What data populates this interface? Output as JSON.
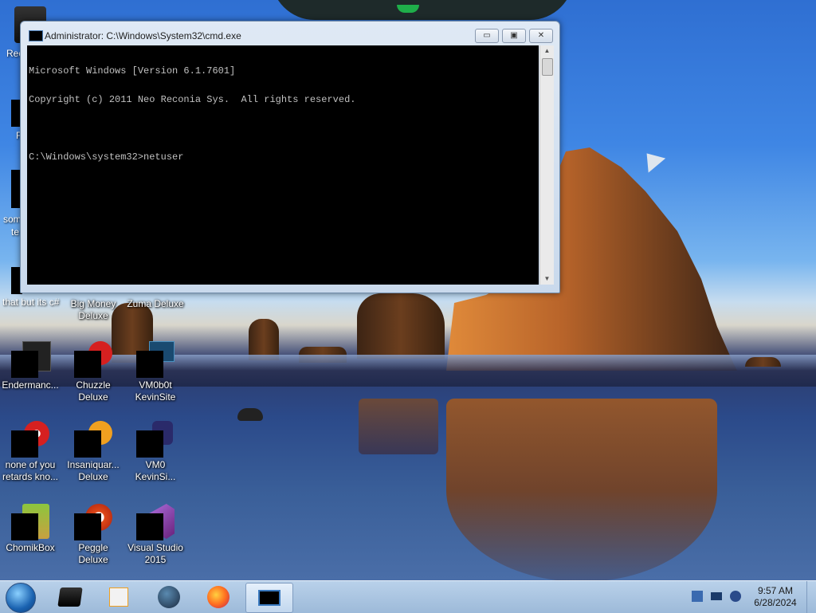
{
  "window": {
    "title": "Administrator: C:\\Windows\\System32\\cmd.exe",
    "minimize_glyph": "▭",
    "maximize_glyph": "▣",
    "close_glyph": "✕",
    "console_lines": [
      "Microsoft Windows [Version 6.1.7601]",
      "Copyright (c) 2011 Neo Reconia Sys.  All rights reserved.",
      "",
      "C:\\Windows\\system32>netuser"
    ]
  },
  "desktop_icons": [
    {
      "label": "Big Money\nDeluxe",
      "icon": "big-money-icon"
    },
    {
      "label": "Zuma Deluxe",
      "icon": "zuma-icon"
    },
    {
      "label": "Endermanc...",
      "icon": "enderman-icon"
    },
    {
      "label": "Chuzzle\nDeluxe",
      "icon": "chuzzle-icon"
    },
    {
      "label": "VM0b0t\nKevinSite",
      "icon": "vm0b0t-icon"
    },
    {
      "label": "none of you\nretards kno...",
      "icon": "shortcut-icon"
    },
    {
      "label": "Insaniquar...\nDeluxe",
      "icon": "insaniquarium-icon"
    },
    {
      "label": "VM0\nKevinSi...",
      "icon": "vm0-icon"
    },
    {
      "label": "ChomikBox",
      "icon": "chomikbox-icon"
    },
    {
      "label": "Peggle Deluxe",
      "icon": "peggle-icon"
    },
    {
      "label": "Visual Studio\n2015",
      "icon": "visual-studio-icon"
    }
  ],
  "partial_labels": {
    "rec": "Rec",
    "f": "F",
    "som": "som",
    "te": "te",
    "that_but": "that but its c#"
  },
  "taskbar": {
    "apps": [
      {
        "name": "terminal-app-icon"
      },
      {
        "name": "media-player-icon"
      },
      {
        "name": "globe-app-icon"
      },
      {
        "name": "firefox-icon"
      },
      {
        "name": "cmd-app-icon",
        "active": true
      }
    ],
    "clock_time": "9:57 AM",
    "clock_date": "6/28/2024"
  },
  "colors": {
    "console_bg": "#000000",
    "console_fg": "#c0c0c0",
    "taskbar": "#b9d1ea"
  }
}
